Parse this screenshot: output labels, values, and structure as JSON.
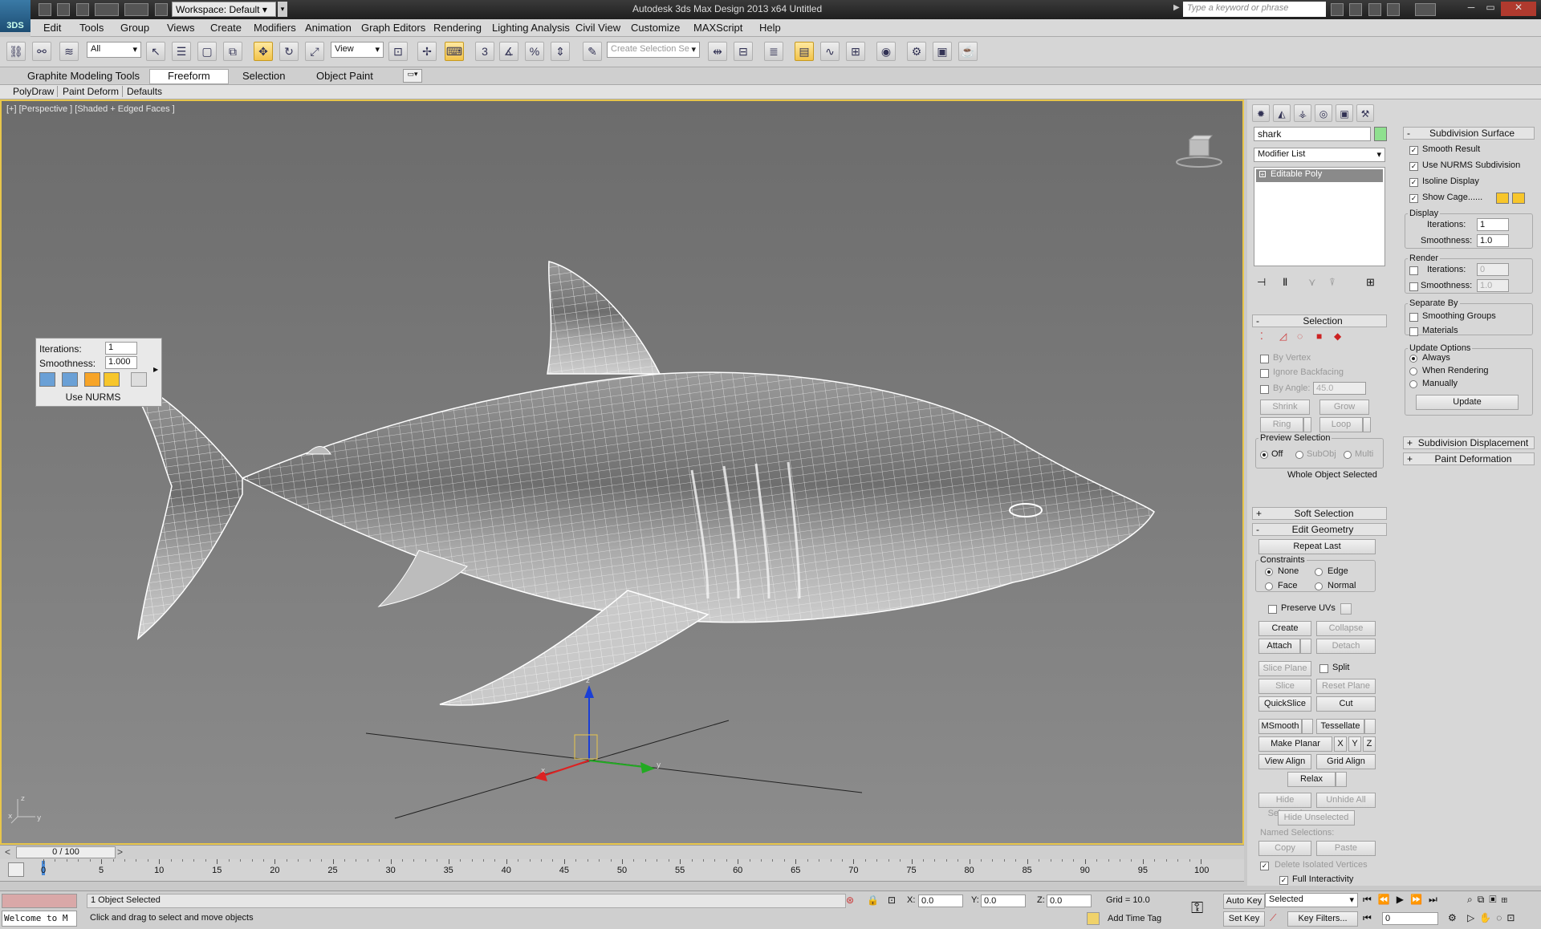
{
  "titlebar": {
    "workspace": "Workspace: Default",
    "app_title": "Autodesk 3ds Max Design 2013 x64    Untitled",
    "search_placeholder": "Type a keyword or phrase",
    "logo": "3DS"
  },
  "menu": [
    "Edit",
    "Tools",
    "Group",
    "Views",
    "Create",
    "Modifiers",
    "Animation",
    "Graph Editors",
    "Rendering",
    "Lighting Analysis",
    "Civil View",
    "Customize",
    "MAXScript",
    "Help"
  ],
  "toolbar": {
    "filter": "All",
    "ref_coord": "View",
    "selection_set_placeholder": "Create Selection Se"
  },
  "ribbon": {
    "tabs": [
      "Graphite Modeling Tools",
      "Freeform",
      "Selection",
      "Object Paint"
    ],
    "active_tab": "Freeform",
    "subtabs": [
      "PolyDraw",
      "Paint Deform",
      "Defaults"
    ]
  },
  "viewport": {
    "label": "[+] [Perspective ] [Shaded + Edged Faces ]"
  },
  "nurms_caddy": {
    "iterations_label": "Iterations:",
    "iterations_value": "1",
    "smoothness_label": "Smoothness:",
    "smoothness_value": "1.000",
    "footer": "Use NURMS"
  },
  "command_panel": {
    "object_name": "shark",
    "modifier_list": "Modifier List",
    "stack_item": "Editable Poly",
    "selection": {
      "title": "Selection",
      "by_vertex": "By Vertex",
      "ignore_backfacing": "Ignore Backfacing",
      "by_angle": "By Angle:",
      "by_angle_value": "45.0",
      "shrink": "Shrink",
      "grow": "Grow",
      "ring": "Ring",
      "loop": "Loop",
      "preview_selection": "Preview Selection",
      "off": "Off",
      "subobj": "SubObj",
      "multi": "Multi",
      "status": "Whole Object Selected"
    },
    "soft_selection": "Soft Selection",
    "edit_geometry": {
      "title": "Edit Geometry",
      "repeat_last": "Repeat Last",
      "constraints": "Constraints",
      "none": "None",
      "edge": "Edge",
      "face": "Face",
      "normal": "Normal",
      "preserve_uvs": "Preserve UVs",
      "create": "Create",
      "collapse": "Collapse",
      "attach": "Attach",
      "detach": "Detach",
      "slice_plane": "Slice Plane",
      "split": "Split",
      "slice": "Slice",
      "reset_plane": "Reset Plane",
      "quickslice": "QuickSlice",
      "cut": "Cut",
      "msmooth": "MSmooth",
      "tessellate": "Tessellate",
      "make_planar": "Make Planar",
      "x": "X",
      "y": "Y",
      "z": "Z",
      "view_align": "View Align",
      "grid_align": "Grid Align",
      "relax": "Relax",
      "hide_selected": "Hide Selected",
      "unhide_all": "Unhide All",
      "hide_unselected": "Hide Unselected",
      "named_selections": "Named Selections:",
      "copy": "Copy",
      "paste": "Paste",
      "delete_isolated": "Delete Isolated Vertices",
      "full_interactivity": "Full Interactivity"
    }
  },
  "subdivision": {
    "title": "Subdivision Surface",
    "smooth_result": "Smooth Result",
    "use_nurms": "Use NURMS Subdivision",
    "isoline_display": "Isoline Display",
    "show_cage": "Show Cage......",
    "display": "Display",
    "iterations": "Iterations:",
    "display_iterations": "1",
    "smoothness": "Smoothness:",
    "display_smoothness": "1.0",
    "render": "Render",
    "render_iterations": "0",
    "render_smoothness": "1.0",
    "separate_by": "Separate By",
    "smoothing_groups": "Smoothing Groups",
    "materials": "Materials",
    "update_options": "Update Options",
    "always": "Always",
    "when_rendering": "When Rendering",
    "manually": "Manually",
    "update": "Update",
    "subdivision_displacement": "Subdivision Displacement",
    "paint_deformation": "Paint Deformation"
  },
  "timeline": {
    "slider": "0 / 100",
    "ticks": [
      "0",
      "5",
      "10",
      "15",
      "20",
      "25",
      "30",
      "35",
      "40",
      "45",
      "50",
      "55",
      "60",
      "65",
      "70",
      "75",
      "80",
      "85",
      "90",
      "95",
      "100"
    ]
  },
  "status": {
    "welcome": "Welcome to M",
    "selected": "1 Object Selected",
    "prompt": "Click and drag to select and move objects",
    "x_label": "X:",
    "x": "0.0",
    "y_label": "Y:",
    "y": "0.0",
    "z_label": "Z:",
    "z": "0.0",
    "grid": "Grid = 10.0",
    "add_time_tag": "Add Time Tag",
    "auto_key": "Auto Key",
    "set_key": "Set Key",
    "key_mode": "Selected",
    "key_filters": "Key Filters...",
    "frame": "0"
  },
  "colors": {
    "viewport_border": "#e8c64b",
    "active_tool": "#f2c34b",
    "cage_color_1": "#f7a427",
    "cage_color_2": "#f7c62b"
  }
}
